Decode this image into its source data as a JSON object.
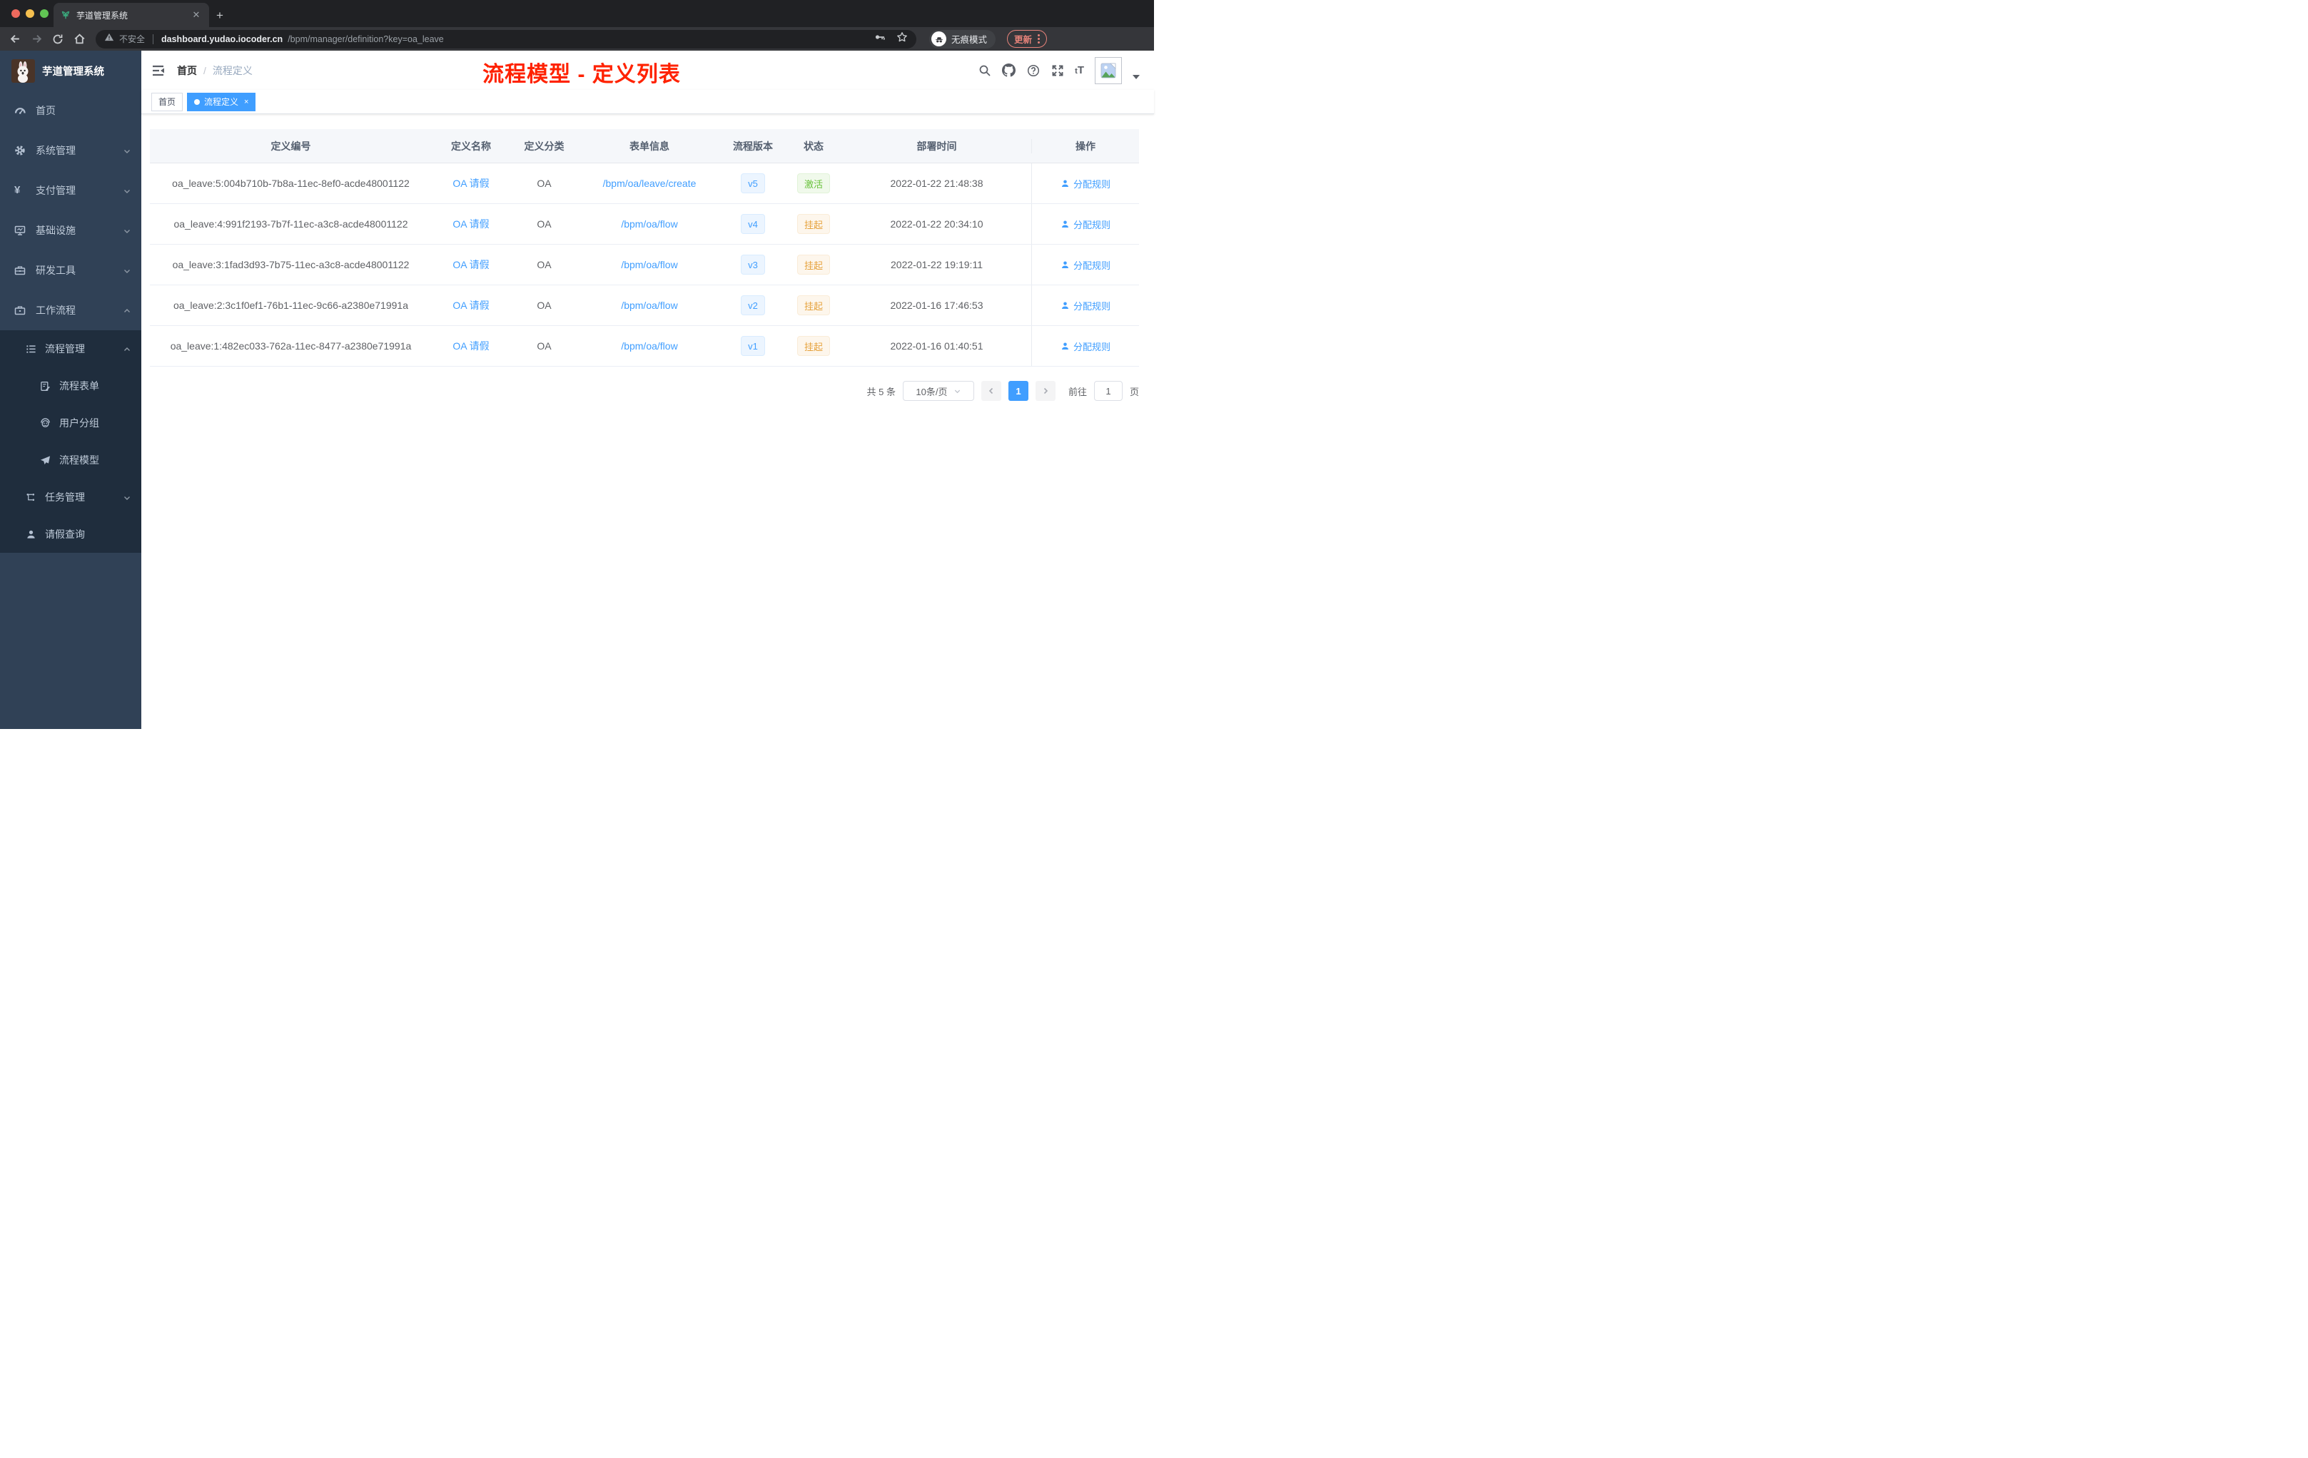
{
  "browser": {
    "tab_title": "芋道管理系统",
    "new_tab_button": "+",
    "security_label": "不安全",
    "url_host": "dashboard.yudao.iocoder.cn",
    "url_path": "/bpm/manager/definition?key=oa_leave",
    "incognito_label": "无痕模式",
    "update_label": "更新"
  },
  "sidebar": {
    "logo_title": "芋道管理系统",
    "menu": [
      {
        "label": "首页",
        "icon": "dashboard-icon"
      },
      {
        "label": "系统管理",
        "icon": "gear-icon"
      },
      {
        "label": "支付管理",
        "icon": "yen-icon"
      },
      {
        "label": "基础设施",
        "icon": "monitor-icon"
      },
      {
        "label": "研发工具",
        "icon": "toolbox-icon"
      },
      {
        "label": "工作流程",
        "icon": "briefcase-icon"
      }
    ],
    "submenu": [
      {
        "label": "流程管理",
        "icon": "list-icon"
      },
      {
        "label": "流程表单",
        "icon": "form-icon"
      },
      {
        "label": "用户分组",
        "icon": "group-icon"
      },
      {
        "label": "流程模型",
        "icon": "send-icon"
      },
      {
        "label": "任务管理",
        "icon": "tree-icon"
      },
      {
        "label": "请假查询",
        "icon": "user-icon"
      }
    ]
  },
  "navbar": {
    "breadcrumb": [
      "首页",
      "流程定义"
    ],
    "breadcrumb_separator": "/",
    "annotation": "流程模型 - 定义列表",
    "font_size_small": "t",
    "font_size_big": "T"
  },
  "tags": [
    {
      "label": "首页"
    },
    {
      "label": "流程定义"
    }
  ],
  "table": {
    "columns": [
      "定义编号",
      "定义名称",
      "定义分类",
      "表单信息",
      "流程版本",
      "状态",
      "部署时间",
      "操作"
    ],
    "rows": [
      {
        "id": "oa_leave:5:004b710b-7b8a-11ec-8ef0-acde48001122",
        "name": "OA 请假",
        "category": "OA",
        "form": "/bpm/oa/leave/create",
        "version": "v5",
        "status": "激活",
        "status_type": "success",
        "deploy_time": "2022-01-22 21:48:38",
        "action": "分配规则"
      },
      {
        "id": "oa_leave:4:991f2193-7b7f-11ec-a3c8-acde48001122",
        "name": "OA 请假",
        "category": "OA",
        "form": "/bpm/oa/flow",
        "version": "v4",
        "status": "挂起",
        "status_type": "warning",
        "deploy_time": "2022-01-22 20:34:10",
        "action": "分配规则"
      },
      {
        "id": "oa_leave:3:1fad3d93-7b75-11ec-a3c8-acde48001122",
        "name": "OA 请假",
        "category": "OA",
        "form": "/bpm/oa/flow",
        "version": "v3",
        "status": "挂起",
        "status_type": "warning",
        "deploy_time": "2022-01-22 19:19:11",
        "action": "分配规则"
      },
      {
        "id": "oa_leave:2:3c1f0ef1-76b1-11ec-9c66-a2380e71991a",
        "name": "OA 请假",
        "category": "OA",
        "form": "/bpm/oa/flow",
        "version": "v2",
        "status": "挂起",
        "status_type": "warning",
        "deploy_time": "2022-01-16 17:46:53",
        "action": "分配规则"
      },
      {
        "id": "oa_leave:1:482ec033-762a-11ec-8477-a2380e71991a",
        "name": "OA 请假",
        "category": "OA",
        "form": "/bpm/oa/flow",
        "version": "v1",
        "status": "挂起",
        "status_type": "warning",
        "deploy_time": "2022-01-16 01:40:51",
        "action": "分配规则"
      }
    ]
  },
  "pagination": {
    "total": "共 5 条",
    "page_size": "10条/页",
    "page": "1",
    "goto_label": "前往",
    "goto_value": "1",
    "unit_label": "页"
  },
  "colors": {
    "accent": "#409eff",
    "success": "#67c23a",
    "warning": "#e6a23c",
    "annotation_red": "#ff2200",
    "sidebar_bg": "#304156",
    "submenu_bg": "#1f2d3d"
  }
}
